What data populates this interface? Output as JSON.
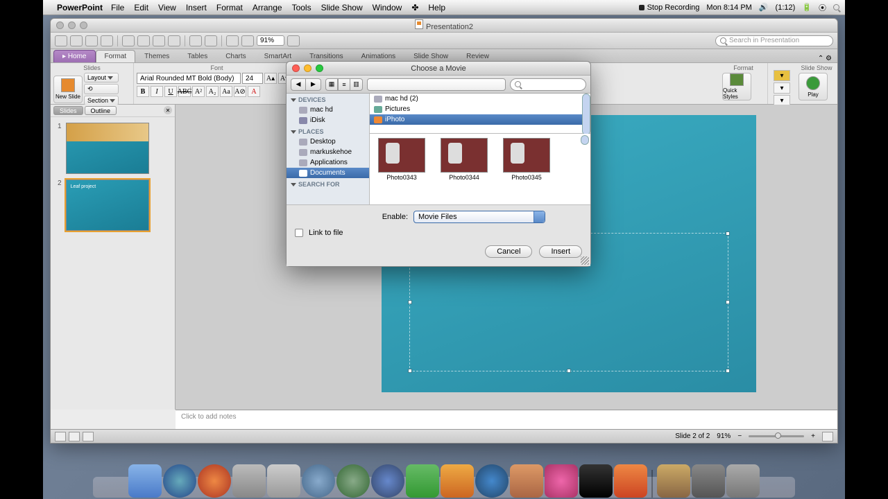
{
  "menubar": {
    "app": "PowerPoint",
    "items": [
      "File",
      "Edit",
      "View",
      "Insert",
      "Format",
      "Arrange",
      "Tools",
      "Slide Show",
      "Window",
      "Help"
    ],
    "stop_rec": "Stop Recording",
    "clock": "Mon 8:14 PM",
    "battery": "(1:12)"
  },
  "window": {
    "title": "Presentation2",
    "zoom": "91%",
    "search_placeholder": "Search in Presentation"
  },
  "ribbon_tabs": [
    "Home",
    "Format",
    "Themes",
    "Tables",
    "Charts",
    "SmartArt",
    "Transitions",
    "Animations",
    "Slide Show",
    "Review"
  ],
  "ribbon": {
    "group_slides": "Slides",
    "new_slide": "New Slide",
    "layout": "Layout",
    "section": "Section",
    "group_font": "Font",
    "font_name": "Arial Rounded MT Bold (Body)",
    "font_size": "24",
    "group_format": "Format",
    "quick_styles": "Quick Styles",
    "group_slideshow": "Slide Show",
    "play": "Play"
  },
  "slide_panel": {
    "tab_slides": "Slides",
    "tab_outline": "Outline",
    "slides": [
      {
        "num": "1",
        "title": ""
      },
      {
        "num": "2",
        "title": "Leaf project"
      }
    ]
  },
  "notes_placeholder": "Click to add notes",
  "status": {
    "slide": "Slide 2 of 2",
    "zoom": "91%"
  },
  "dialog": {
    "title": "Choose a Movie",
    "sidebar": {
      "devices": "DEVICES",
      "devices_items": [
        "mac hd",
        "iDisk"
      ],
      "places": "PLACES",
      "places_items": [
        "Desktop",
        "markuskehoe",
        "Applications",
        "Documents"
      ],
      "search": "SEARCH FOR"
    },
    "col1": [
      "mac hd (2)",
      "Pictures",
      "iPhoto"
    ],
    "thumbs": [
      "Photo0343",
      "Photo0344",
      "Photo0345"
    ],
    "enable_label": "Enable:",
    "enable_value": "Movie Files",
    "link_to_file": "Link to file",
    "cancel": "Cancel",
    "insert": "Insert"
  }
}
